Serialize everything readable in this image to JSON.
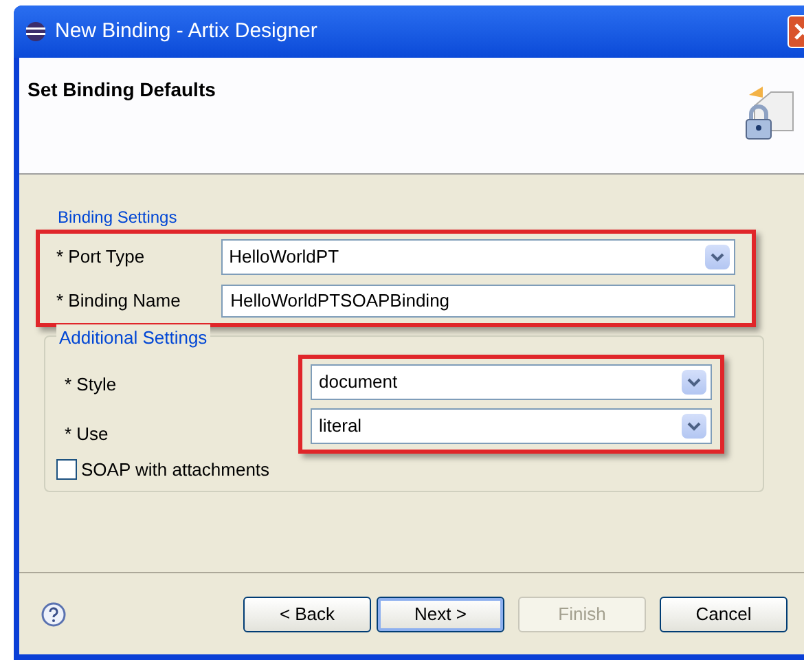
{
  "window": {
    "title": "New Binding - Artix Designer"
  },
  "header": {
    "title": "Set Binding Defaults"
  },
  "binding_settings": {
    "legend": "Binding Settings",
    "highlighted": true,
    "fields": [
      {
        "kind": "dropdown",
        "label": "* Port Type",
        "value": "HelloWorldPT"
      },
      {
        "kind": "text",
        "label": "* Binding Name",
        "value": "HelloWorldPTSOAPBinding"
      }
    ]
  },
  "additional_settings": {
    "legend": "Additional Settings",
    "highlighted": true,
    "fields": [
      {
        "kind": "dropdown",
        "label": "* Style",
        "value": "document"
      },
      {
        "kind": "dropdown",
        "label": "* Use",
        "value": "literal"
      }
    ],
    "checkbox": {
      "label": "SOAP with attachments",
      "checked": false
    }
  },
  "buttons": [
    {
      "label": "< Back",
      "disabled": false,
      "default": false
    },
    {
      "label": "Next >",
      "disabled": false,
      "default": true
    },
    {
      "label": "Finish",
      "disabled": true,
      "default": false
    },
    {
      "label": "Cancel",
      "disabled": false,
      "default": false
    }
  ]
}
